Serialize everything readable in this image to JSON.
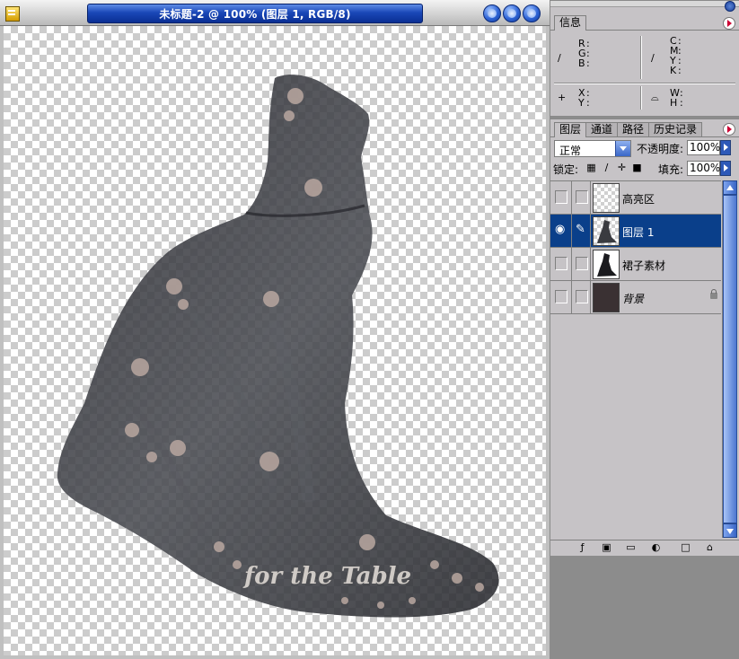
{
  "document": {
    "title": "未标题-2 @ 100% (图层 1, RGB/8)",
    "canvas_caption": "for the Table"
  },
  "info_panel": {
    "tab": "信息",
    "rgb_labels": [
      "R",
      "G",
      "B"
    ],
    "cmyk_labels": [
      "C",
      "M",
      "Y",
      "K"
    ],
    "xy_labels": [
      "X",
      "Y"
    ],
    "wh_labels": [
      "W",
      "H"
    ],
    "crosshair_glyph": "+",
    "eyedropper_glyph": "∕",
    "measure_glyph": "⌓",
    "rgb_colon": ":",
    "cmyk_colon": ":"
  },
  "layers_panel": {
    "tabs": [
      "图层",
      "通道",
      "路径",
      "历史记录"
    ],
    "blend_mode": "正常",
    "opacity_label": "不透明度:",
    "opacity_value": "100%",
    "lock_label": "锁定:",
    "fill_label": "填充:",
    "fill_value": "100%",
    "layers": [
      {
        "name": "高亮区",
        "visible": false,
        "selected": false
      },
      {
        "name": "图层 1",
        "visible": true,
        "selected": true
      },
      {
        "name": "裙子素材",
        "visible": false,
        "selected": false
      },
      {
        "name": "背景",
        "visible": false,
        "selected": false,
        "locked": true
      }
    ]
  },
  "icons": {
    "eye": "◉",
    "brush": "✎",
    "lock_transparent": "▦",
    "lock_paint": "∕",
    "lock_move": "✛",
    "lock_all": "■",
    "fx": "ƒ",
    "mask": "▣",
    "folder": "▭",
    "adjustment": "◐",
    "new_layer": "□",
    "trash": "⌂"
  },
  "colors": {
    "title_blue": "#1a47b8",
    "selection": "#0a3f8a",
    "panel_bg": "#c6c3c6",
    "dress": "#3a3a40"
  }
}
